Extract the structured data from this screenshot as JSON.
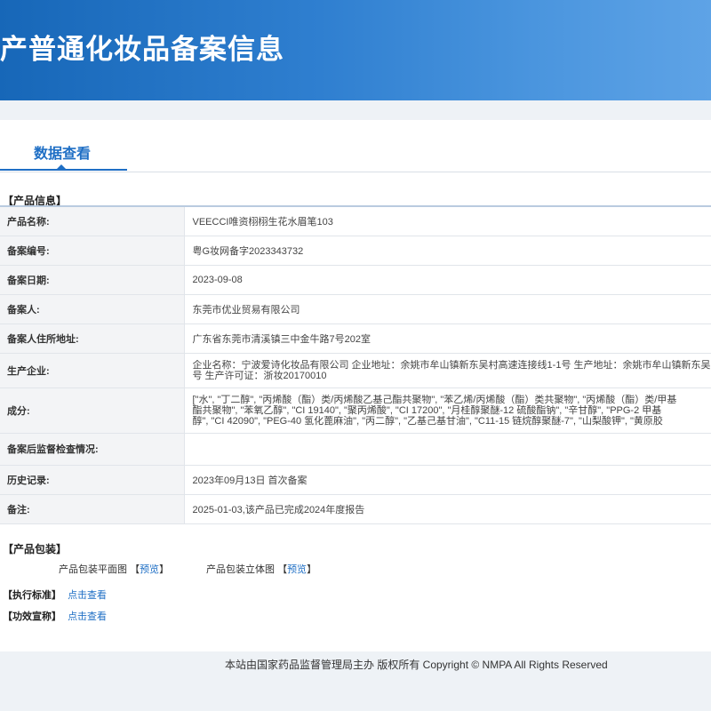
{
  "banner": {
    "title": "国产普通化妆品备案信息"
  },
  "tabs": [
    {
      "label": "数据查看"
    }
  ],
  "product_section": {
    "title": "【产品信息】"
  },
  "product_info": {
    "name_label": "产品名称:",
    "name_value": "VEECCI唯资栩栩生花水眉笔103",
    "record_no_label": "备案编号:",
    "record_no_value": "粤G妆网备字2023343732",
    "record_date_label": "备案日期:",
    "record_date_value": "2023-09-08",
    "filer_label": "备案人:",
    "filer_value": "东莞市优业贸易有限公司",
    "filer_address_label": "备案人住所地址:",
    "filer_address_value": "广东省东莞市清溪镇三中金牛路7号202室",
    "manufacturer_label": "生产企业:",
    "manufacturer_line1": "企业名称：宁波爱诗化妆品有限公司 企业地址：余姚市牟山镇新东吴村高速连接线1-1号 生产地址：余姚市牟山镇新东吴",
    "manufacturer_line2": "号 生产许可证：浙妆20170010",
    "ingredients_label": "成分:",
    "ingredients_line1": "[\"水\", \"丁二醇\", \"丙烯酸（酯）类/丙烯酸乙基己酯共聚物\", \"苯乙烯/丙烯酸（酯）类共聚物\", \"丙烯酸（酯）类/甲基",
    "ingredients_line2": "酯共聚物\", \"苯氧乙醇\", \"CI 19140\", \"聚丙烯酸\", \"CI 17200\", \"月桂醇聚醚-12 硫酸酯钠\", \"辛甘醇\", \"PPG-2 甲基",
    "ingredients_line3": "醇\", \"CI 42090\", \"PEG-40 氢化蓖麻油\", \"丙二醇\", \"乙基己基甘油\", \"C11-15 链烷醇聚醚-7\", \"山梨酸钾\", \"黄原胶",
    "supervision_label": "备案后监督检查情况:",
    "supervision_value": "",
    "history_label": "历史记录:",
    "history_value": "2023年09月13日 首次备案",
    "remarks_label": "备注:",
    "remarks_value": "2025-01-03,该产品已完成2024年度报告"
  },
  "packaging_section": {
    "title": "【产品包装】",
    "flat_label": "产品包装平面图",
    "flat_preview": "预览",
    "three_d_label": "产品包装立体图",
    "three_d_preview": "预览",
    "open_bracket": "【",
    "close_bracket": "】"
  },
  "standard": {
    "label": "【执行标准】",
    "link": "点击查看"
  },
  "efficacy": {
    "label": "【功效宣称】",
    "link": "点击查看"
  },
  "footer": {
    "text": "本站由国家药品监督管理局主办 版权所有 Copyright © NMPA All Rights Reserved"
  }
}
